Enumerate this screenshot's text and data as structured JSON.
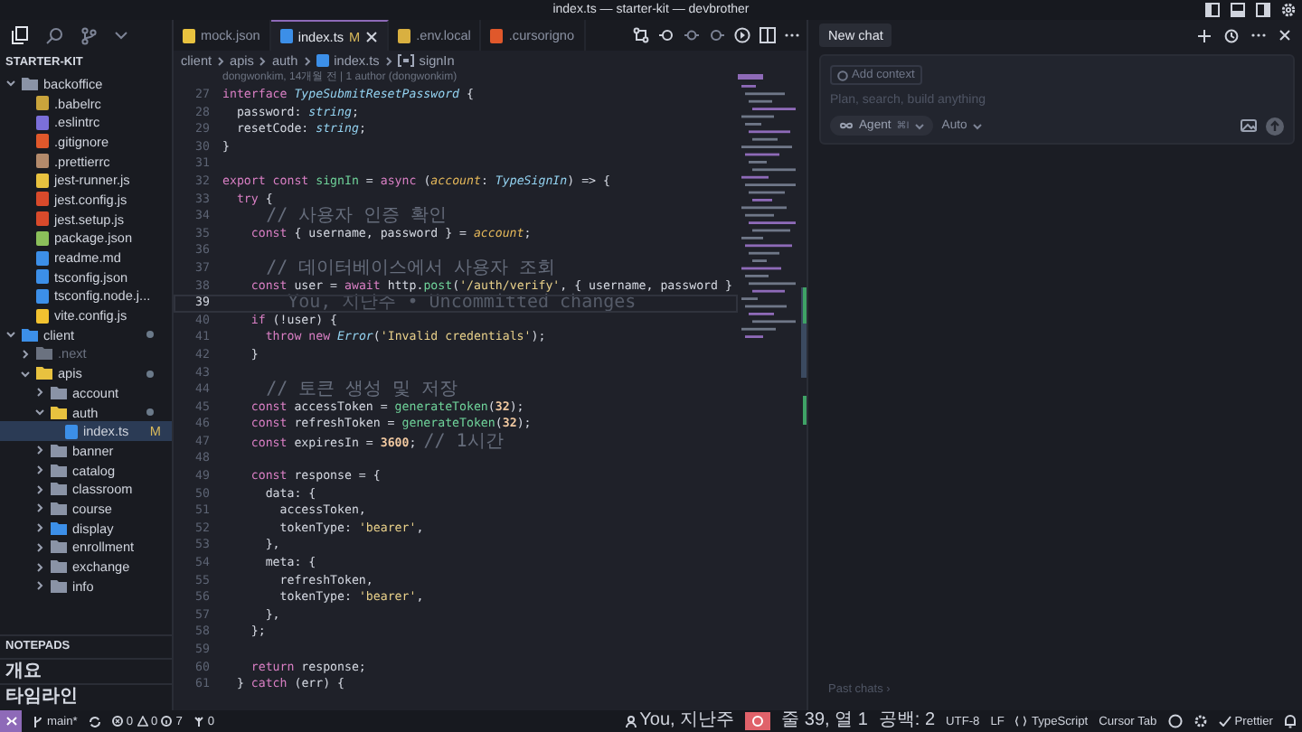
{
  "window": {
    "title": "index.ts — starter-kit — devbrother"
  },
  "sidebar": {
    "section": "STARTER-KIT",
    "tree": [
      {
        "name": "backoffice",
        "kind": "folder",
        "expanded": true,
        "selected": false,
        "modified": false,
        "color": "#8a93a6",
        "children": [
          {
            "name": ".babelrc",
            "kind": "file",
            "selected": false,
            "modified": false,
            "color": "#c9a43c"
          },
          {
            "name": ".eslintrc",
            "kind": "file",
            "selected": false,
            "modified": false,
            "color": "#7b6fd9"
          },
          {
            "name": ".gitignore",
            "kind": "file",
            "selected": false,
            "modified": false,
            "color": "#e0582b"
          },
          {
            "name": ".prettierrc",
            "kind": "file",
            "selected": false,
            "modified": false,
            "color": "#b38a6b"
          },
          {
            "name": "jest-runner.js",
            "kind": "file",
            "selected": false,
            "modified": false,
            "color": "#e8c23f"
          },
          {
            "name": "jest.config.js",
            "kind": "file",
            "selected": false,
            "modified": false,
            "color": "#d94a2b"
          },
          {
            "name": "jest.setup.js",
            "kind": "file",
            "selected": false,
            "modified": false,
            "color": "#d94a2b"
          },
          {
            "name": "package.json",
            "kind": "file",
            "selected": false,
            "modified": false,
            "color": "#8bbf5a"
          },
          {
            "name": "readme.md",
            "kind": "file",
            "selected": false,
            "modified": false,
            "color": "#3c8fe8"
          },
          {
            "name": "tsconfig.json",
            "kind": "file",
            "selected": false,
            "modified": false,
            "color": "#3c8fe8"
          },
          {
            "name": "tsconfig.node.j...",
            "kind": "file",
            "selected": false,
            "modified": false,
            "color": "#3c8fe8"
          },
          {
            "name": "vite.config.js",
            "kind": "file",
            "selected": false,
            "modified": false,
            "color": "#f2c230"
          }
        ]
      },
      {
        "name": "client",
        "kind": "folder",
        "expanded": true,
        "selected": false,
        "modified": true,
        "color": "#3c8fe8",
        "children": [
          {
            "name": ".next",
            "kind": "folder",
            "expanded": false,
            "selected": false,
            "modified": false,
            "color": "#6b7280"
          },
          {
            "name": "apis",
            "kind": "folder",
            "expanded": true,
            "selected": false,
            "modified": true,
            "color": "#e8c23f",
            "children": [
              {
                "name": "account",
                "kind": "folder",
                "expanded": false,
                "selected": false,
                "modified": false,
                "color": "#8a93a6"
              },
              {
                "name": "auth",
                "kind": "folder",
                "expanded": true,
                "selected": false,
                "modified": true,
                "color": "#e8c23f",
                "children": [
                  {
                    "name": "index.ts",
                    "kind": "file",
                    "selected": true,
                    "modified": false,
                    "badge": "M",
                    "color": "#3c8fe8"
                  }
                ]
              },
              {
                "name": "banner",
                "kind": "folder",
                "expanded": false,
                "selected": false,
                "modified": false,
                "color": "#8a93a6"
              },
              {
                "name": "catalog",
                "kind": "folder",
                "expanded": false,
                "selected": false,
                "modified": false,
                "color": "#8a93a6"
              },
              {
                "name": "classroom",
                "kind": "folder",
                "expanded": false,
                "selected": false,
                "modified": false,
                "color": "#8a93a6"
              },
              {
                "name": "course",
                "kind": "folder",
                "expanded": false,
                "selected": false,
                "modified": false,
                "color": "#8a93a6"
              },
              {
                "name": "display",
                "kind": "folder",
                "expanded": false,
                "selected": false,
                "modified": false,
                "color": "#3c8fe8"
              },
              {
                "name": "enrollment",
                "kind": "folder",
                "expanded": false,
                "selected": false,
                "modified": false,
                "color": "#8a93a6"
              },
              {
                "name": "exchange",
                "kind": "folder",
                "expanded": false,
                "selected": false,
                "modified": false,
                "color": "#8a93a6"
              },
              {
                "name": "info",
                "kind": "folder",
                "expanded": false,
                "selected": false,
                "modified": false,
                "color": "#8a93a6"
              }
            ]
          }
        ]
      }
    ],
    "panels": [
      "NOTEPADS",
      "개요",
      "타임라인"
    ]
  },
  "tabs": [
    {
      "label": "mock.json",
      "selected": false,
      "color": "#e8c23f"
    },
    {
      "label": "index.ts",
      "badge": "M",
      "selected": true,
      "color": "#3c8fe8"
    },
    {
      "label": ".env.local",
      "selected": false,
      "color": "#d9b040"
    },
    {
      "label": ".cursorigno",
      "selected": false,
      "color": "#e0582b"
    }
  ],
  "breadcrumb": [
    {
      "label": "client",
      "kind": "folder"
    },
    {
      "label": "apis",
      "kind": "folder"
    },
    {
      "label": "auth",
      "kind": "folder"
    },
    {
      "label": "index.ts",
      "kind": "file"
    },
    {
      "label": "signIn",
      "kind": "symbol"
    }
  ],
  "blame": "dongwonkim, 14개월 전 | 1 author (dongwonkim)",
  "code": [
    {
      "number": "27",
      "current": false,
      "segments": [
        {
          "kind": "kw",
          "text": "interface "
        },
        {
          "kind": "type",
          "text": "TypeSubmitResetPassword"
        },
        {
          "kind": "p",
          "text": " {"
        }
      ]
    },
    {
      "number": "28",
      "current": false,
      "segments": [
        {
          "kind": "p",
          "text": "  password: "
        },
        {
          "kind": "type",
          "text": "string"
        },
        {
          "kind": "p",
          "text": ";"
        }
      ]
    },
    {
      "number": "29",
      "current": false,
      "segments": [
        {
          "kind": "p",
          "text": "  resetCode: "
        },
        {
          "kind": "type",
          "text": "string"
        },
        {
          "kind": "p",
          "text": ";"
        }
      ]
    },
    {
      "number": "30",
      "current": false,
      "segments": [
        {
          "kind": "p",
          "text": "}"
        }
      ]
    },
    {
      "number": "31",
      "current": false
    },
    {
      "number": "32",
      "current": false,
      "segments": [
        {
          "kind": "kw",
          "text": "export const "
        },
        {
          "kind": "fn",
          "text": "signIn"
        },
        {
          "kind": "p",
          "text": " = "
        },
        {
          "kind": "kw",
          "text": "async "
        },
        {
          "kind": "p",
          "text": "("
        },
        {
          "kind": "param",
          "text": "account"
        },
        {
          "kind": "p",
          "text": ": "
        },
        {
          "kind": "type",
          "text": "TypeSignIn"
        },
        {
          "kind": "p",
          "text": ") => {"
        }
      ]
    },
    {
      "number": "33",
      "current": false,
      "segments": [
        {
          "kind": "kw",
          "text": "  try"
        },
        {
          "kind": "p",
          "text": " {"
        }
      ]
    },
    {
      "number": "34",
      "current": false,
      "segments": [
        {
          "kind": "cmt",
          "text": "    // 사용자 인증 확인"
        }
      ]
    },
    {
      "number": "35",
      "current": false,
      "segments": [
        {
          "kind": "kw",
          "text": "    const"
        },
        {
          "kind": "p",
          "text": " { username, password } = "
        },
        {
          "kind": "param",
          "text": "account"
        },
        {
          "kind": "p",
          "text": ";"
        }
      ]
    },
    {
      "number": "36",
      "current": false
    },
    {
      "number": "37",
      "current": false,
      "segments": [
        {
          "kind": "cmt",
          "text": "    // 데이터베이스에서 사용자 조회"
        }
      ]
    },
    {
      "number": "38",
      "current": false,
      "segments": [
        {
          "kind": "kw",
          "text": "    const"
        },
        {
          "kind": "p",
          "text": " user = "
        },
        {
          "kind": "kw",
          "text": "await"
        },
        {
          "kind": "p",
          "text": " http."
        },
        {
          "kind": "fn",
          "text": "post"
        },
        {
          "kind": "p",
          "text": "("
        },
        {
          "kind": "str",
          "text": "'/auth/verify'"
        },
        {
          "kind": "p",
          "text": ", { username, password }"
        }
      ]
    },
    {
      "number": "39",
      "current": true,
      "segments": [
        {
          "kind": "ghost",
          "text": "      You, 지난주 • Uncommitted changes"
        }
      ]
    },
    {
      "number": "40",
      "current": false,
      "segments": [
        {
          "kind": "kw",
          "text": "    if"
        },
        {
          "kind": "p",
          "text": " (!user) {"
        }
      ]
    },
    {
      "number": "41",
      "current": false,
      "segments": [
        {
          "kind": "kw",
          "text": "      throw new "
        },
        {
          "kind": "type",
          "text": "Error"
        },
        {
          "kind": "p",
          "text": "("
        },
        {
          "kind": "str",
          "text": "'Invalid credentials'"
        },
        {
          "kind": "p",
          "text": ");"
        }
      ]
    },
    {
      "number": "42",
      "current": false,
      "segments": [
        {
          "kind": "p",
          "text": "    }"
        }
      ]
    },
    {
      "number": "43",
      "current": false
    },
    {
      "number": "44",
      "current": false,
      "segments": [
        {
          "kind": "cmt",
          "text": "    // 토큰 생성 및 저장"
        }
      ]
    },
    {
      "number": "45",
      "current": false,
      "segments": [
        {
          "kind": "kw",
          "text": "    const"
        },
        {
          "kind": "p",
          "text": " accessToken = "
        },
        {
          "kind": "fn",
          "text": "generateToken"
        },
        {
          "kind": "p",
          "text": "("
        },
        {
          "kind": "num",
          "text": "32"
        },
        {
          "kind": "p",
          "text": ");"
        }
      ]
    },
    {
      "number": "46",
      "current": false,
      "segments": [
        {
          "kind": "kw",
          "text": "    const"
        },
        {
          "kind": "p",
          "text": " refreshToken = "
        },
        {
          "kind": "fn",
          "text": "generateToken"
        },
        {
          "kind": "p",
          "text": "("
        },
        {
          "kind": "num",
          "text": "32"
        },
        {
          "kind": "p",
          "text": ");"
        }
      ]
    },
    {
      "number": "47",
      "current": false,
      "segments": [
        {
          "kind": "kw",
          "text": "    const"
        },
        {
          "kind": "p",
          "text": " expiresIn = "
        },
        {
          "kind": "num",
          "text": "3600"
        },
        {
          "kind": "p",
          "text": "; "
        },
        {
          "kind": "cmt",
          "text": "// 1시간"
        }
      ]
    },
    {
      "number": "48",
      "current": false
    },
    {
      "number": "49",
      "current": false,
      "segments": [
        {
          "kind": "kw",
          "text": "    const"
        },
        {
          "kind": "p",
          "text": " response = {"
        }
      ]
    },
    {
      "number": "50",
      "current": false,
      "segments": [
        {
          "kind": "p",
          "text": "      data: {"
        }
      ]
    },
    {
      "number": "51",
      "current": false,
      "segments": [
        {
          "kind": "p",
          "text": "        accessToken,"
        }
      ]
    },
    {
      "number": "52",
      "current": false,
      "segments": [
        {
          "kind": "p",
          "text": "        tokenType: "
        },
        {
          "kind": "str",
          "text": "'bearer'"
        },
        {
          "kind": "p",
          "text": ","
        }
      ]
    },
    {
      "number": "53",
      "current": false,
      "segments": [
        {
          "kind": "p",
          "text": "      },"
        }
      ]
    },
    {
      "number": "54",
      "current": false,
      "segments": [
        {
          "kind": "p",
          "text": "      meta: {"
        }
      ]
    },
    {
      "number": "55",
      "current": false,
      "segments": [
        {
          "kind": "p",
          "text": "        refreshToken,"
        }
      ]
    },
    {
      "number": "56",
      "current": false,
      "segments": [
        {
          "kind": "p",
          "text": "        tokenType: "
        },
        {
          "kind": "str",
          "text": "'bearer'"
        },
        {
          "kind": "p",
          "text": ","
        }
      ]
    },
    {
      "number": "57",
      "current": false,
      "segments": [
        {
          "kind": "p",
          "text": "      },"
        }
      ]
    },
    {
      "number": "58",
      "current": false,
      "segments": [
        {
          "kind": "p",
          "text": "    };"
        }
      ]
    },
    {
      "number": "59",
      "current": false
    },
    {
      "number": "60",
      "current": false,
      "segments": [
        {
          "kind": "kw",
          "text": "    return"
        },
        {
          "kind": "p",
          "text": " response;"
        }
      ]
    },
    {
      "number": "61",
      "current": false,
      "segments": [
        {
          "kind": "p",
          "text": "  } "
        },
        {
          "kind": "kw",
          "text": "catch"
        },
        {
          "kind": "p",
          "text": " (err) {"
        }
      ]
    }
  ],
  "chat": {
    "tab": "New chat",
    "context_chip": "Add context",
    "placeholder": "Plan, search, build anything",
    "mode": "Agent",
    "mode_shortcut": "⌘I",
    "model": "Auto",
    "past_chats": "Past chats ›"
  },
  "status_bar": {
    "branch": "main*",
    "errors": "0",
    "warnings": "0",
    "infos": "7",
    "ports": "0",
    "blame": "You, 지난주",
    "position": "줄 39, 열 1",
    "indent": "공백: 2",
    "encoding": "UTF-8",
    "eol": "LF",
    "language": "TypeScript",
    "tab_mode": "Cursor Tab",
    "formatter": "Prettier"
  }
}
